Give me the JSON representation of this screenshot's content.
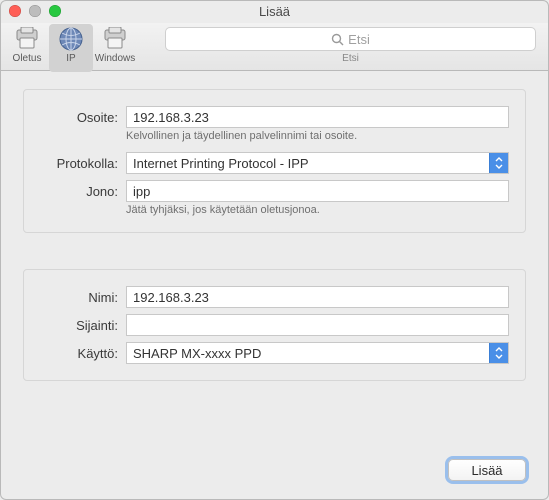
{
  "window": {
    "title": "Lisää"
  },
  "toolbar": {
    "items": [
      {
        "label": "Oletus"
      },
      {
        "label": "IP"
      },
      {
        "label": "Windows"
      }
    ],
    "search": {
      "placeholder": "Etsi",
      "caption": "Etsi"
    }
  },
  "form": {
    "osoite": {
      "label": "Osoite:",
      "value": "192.168.3.23",
      "hint": "Kelvollinen ja täydellinen palvelinnimi tai osoite."
    },
    "protokolla": {
      "label": "Protokolla:",
      "value": "Internet Printing Protocol - IPP"
    },
    "jono": {
      "label": "Jono:",
      "value": "ipp",
      "hint": "Jätä tyhjäksi, jos käytetään oletusjonoa."
    },
    "nimi": {
      "label": "Nimi:",
      "value": "192.168.3.23"
    },
    "sijainti": {
      "label": "Sijainti:",
      "value": ""
    },
    "kaytto": {
      "label": "Käyttö:",
      "value": "SHARP MX-xxxx PPD"
    }
  },
  "footer": {
    "add": "Lisää"
  }
}
